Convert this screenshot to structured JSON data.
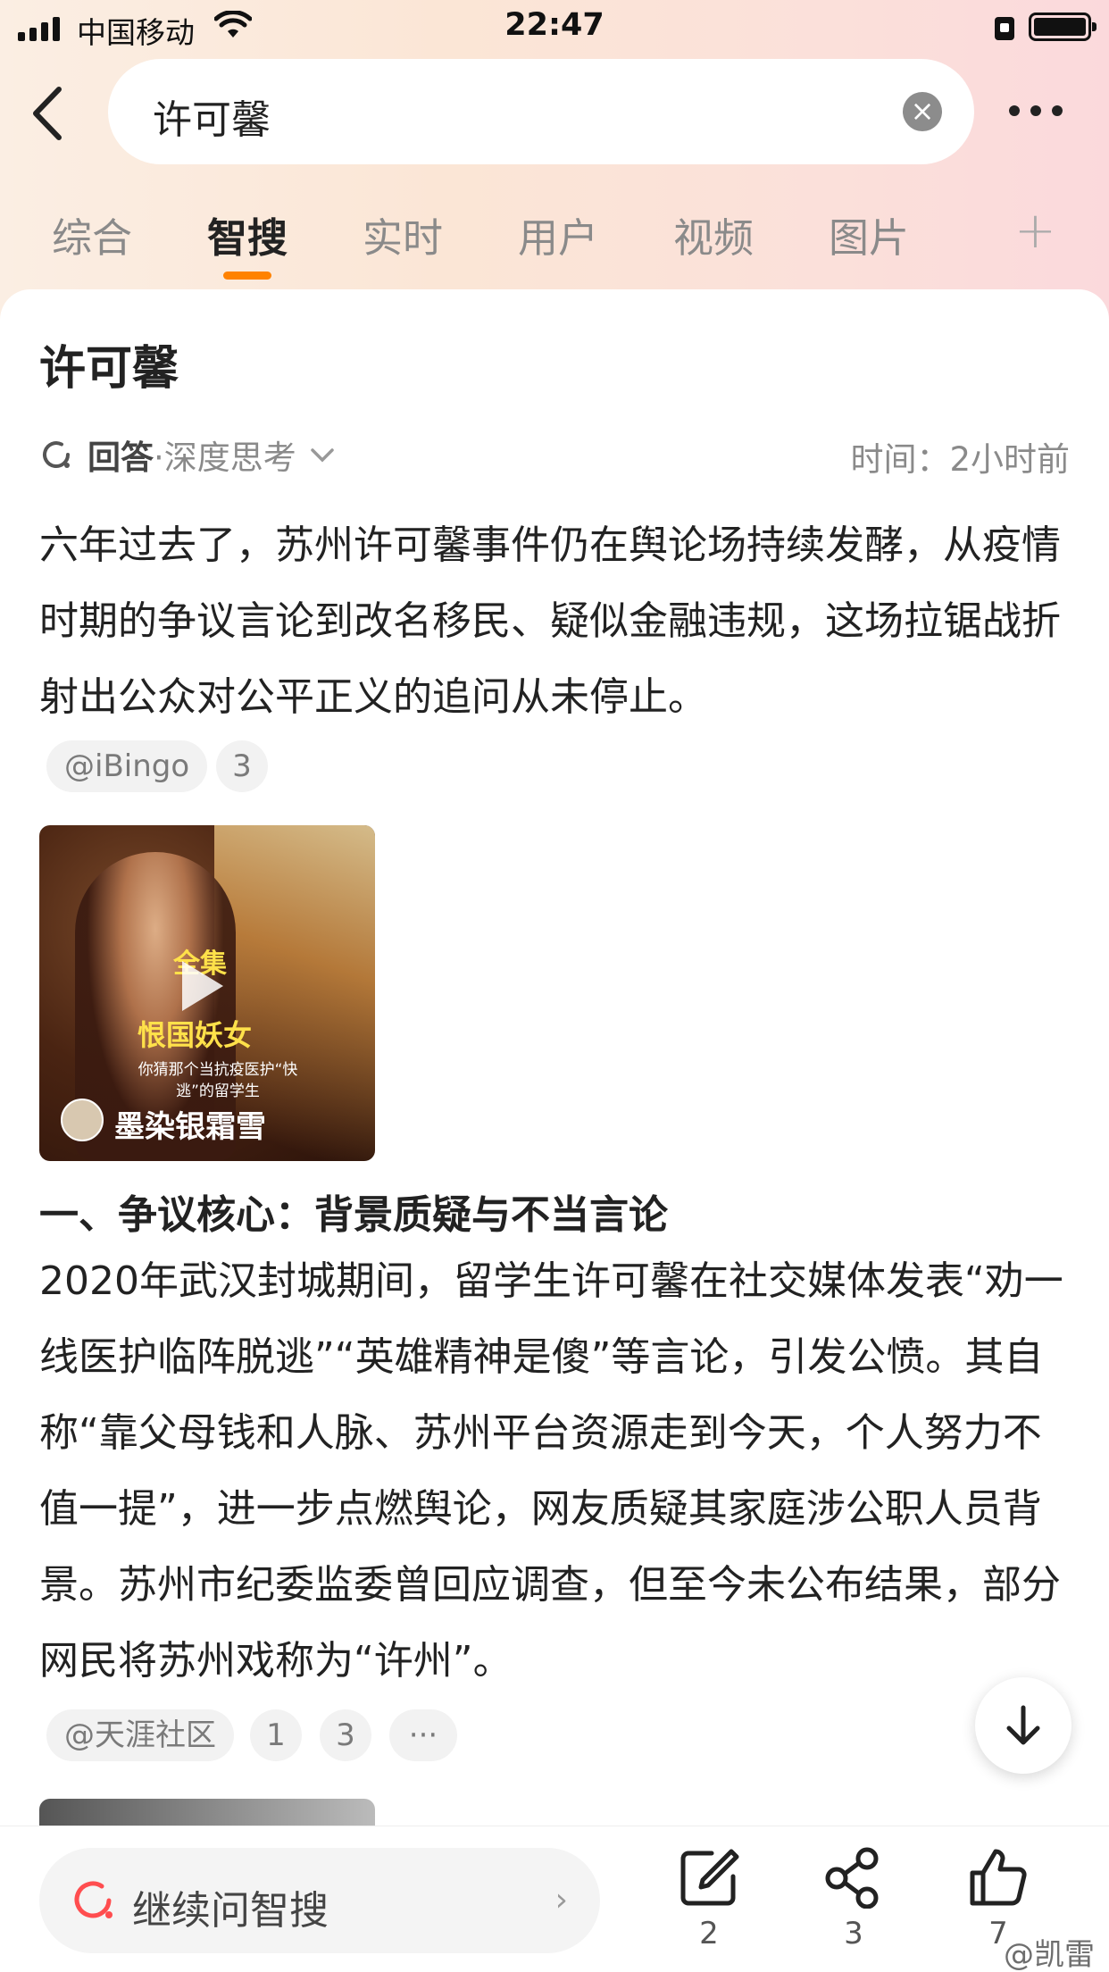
{
  "status_bar": {
    "carrier": "中国移动",
    "time": "22:47"
  },
  "search": {
    "query": "许可馨",
    "clear_symbol": "×"
  },
  "tabs": [
    {
      "label": "综合"
    },
    {
      "label": "智搜"
    },
    {
      "label": "实时"
    },
    {
      "label": "用户"
    },
    {
      "label": "视频"
    },
    {
      "label": "图片"
    }
  ],
  "tab_add_symbol": "+",
  "content": {
    "title": "许可馨",
    "answer_label": "回答",
    "answer_mode": "·深度思考",
    "time_label": "时间：2小时前",
    "intro": "六年过去了，苏州许可馨事件仍在舆论场持续发酵，从疫情时期的争议言论到改名移民、疑似金融违规，这场拉锯战折射出公众对公平正义的追问从未停止。",
    "intro_sources": {
      "source": "@iBingo",
      "count": "3"
    },
    "video": {
      "overlay_line1": "全集",
      "overlay_line2": "恨国妖女",
      "overlay_line3": "你猜那个当抗疫医护“快逃”的留学生",
      "author": "墨染银霜雪"
    },
    "section1_heading": "一、争议核心：背景质疑与不当言论",
    "section1_body": "2020年武汉封城期间，留学生许可馨在社交媒体发表“劝一线医护临阵脱逃”“英雄精神是傻”等言论，引发公愤。其自称“靠父母钱和人脉、苏州平台资源走到今天，个人努力不值一提”，进一步点燃舆论，网友质疑其家庭涉公职人员背景。苏州市纪委监委曾回应调查，但至今未公布结果，部分网民将苏州戏称为“许州”。",
    "section1_sources": {
      "source": "@天涯社区",
      "ref1": "1",
      "ref2": "3",
      "more": "···"
    }
  },
  "bottom_bar": {
    "ask_placeholder": "继续问智搜",
    "ask_chevron": "›",
    "comment_count": "2",
    "share_count": "3",
    "like_count": "7",
    "watermark": "@凯雷"
  },
  "colors": {
    "accent": "#ff8200",
    "brand_search": "#ff4d4f"
  }
}
